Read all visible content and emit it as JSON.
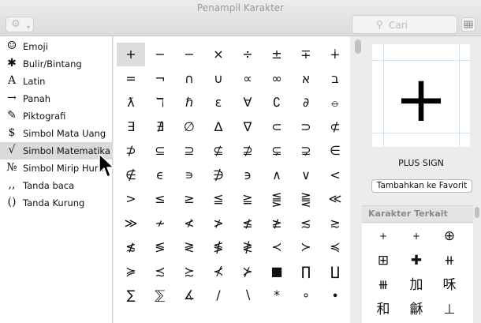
{
  "window": {
    "title": "Penampil Karakter"
  },
  "toolbar": {
    "gear_icon": "gear-icon",
    "search_placeholder": "Cari"
  },
  "sidebar": {
    "items": [
      {
        "icon": "☺",
        "label": "Emoji"
      },
      {
        "icon": "✱",
        "label": "Bulir/Bintang"
      },
      {
        "icon": "A",
        "label": "Latin"
      },
      {
        "icon": "→",
        "label": "Panah"
      },
      {
        "icon": "✎",
        "label": "Piktografi"
      },
      {
        "icon": "$",
        "label": "Simbol Mata Uang"
      },
      {
        "icon": "√",
        "label": "Simbol Matematika",
        "selected": true
      },
      {
        "icon": "№",
        "label": "Simbol Mirip Huruf"
      },
      {
        "icon": ",,",
        "label": "Tanda baca"
      },
      {
        "icon": "()",
        "label": "Tanda Kurung"
      }
    ]
  },
  "grid": {
    "selected_index": 0,
    "rows": [
      [
        "+",
        "−",
        "−",
        "×",
        "÷",
        "±",
        "∓",
        "∔"
      ],
      [
        "=",
        "¬",
        "∩",
        "∪",
        "∝",
        "∞",
        "א",
        "ב"
      ],
      [
        "ƛ",
        "ℸ",
        "ℏ",
        "ɛ",
        "∀",
        "∁",
        "∂",
        "⦵"
      ],
      [
        "∃",
        "∄",
        "∅",
        "∆",
        "∇",
        "⊂",
        "⊃",
        "⊄"
      ],
      [
        "⊅",
        "⊆",
        "⊇",
        "⊈",
        "⊉",
        "⊊",
        "⊋",
        "∈"
      ],
      [
        "∉",
        "ϵ",
        "∍",
        "∌",
        "϶",
        "∧",
        "∨",
        "<"
      ],
      [
        ">",
        "≤",
        "≥",
        "≦",
        "≧",
        "⪋",
        "⪌",
        "≪"
      ],
      [
        "≫",
        "≁",
        "≮",
        "≯",
        "≰",
        "≱",
        "≲",
        "≳"
      ],
      [
        "≴",
        "≶",
        "≷",
        "≸",
        "≹",
        "≺",
        "≻",
        "≼"
      ],
      [
        "≽",
        "≾",
        "≿",
        "⊀",
        "⊁",
        "■",
        "∏",
        "∐"
      ],
      [
        "∑",
        "⅀",
        "∡",
        "/",
        "∖",
        "*",
        "∘",
        "∙"
      ]
    ]
  },
  "detail": {
    "glyph": "+",
    "name": "PLUS SIGN",
    "favorite_button": "Tambahkan ke Favorit",
    "related_header": "Karakter Terkait",
    "related": [
      [
        "+",
        "+",
        "⊕"
      ],
      [
        "⊞",
        "✚",
        "⧺"
      ],
      [
        "⧻",
        "加",
        "咊"
      ],
      [
        "和",
        "龢",
        "⊥"
      ]
    ]
  }
}
